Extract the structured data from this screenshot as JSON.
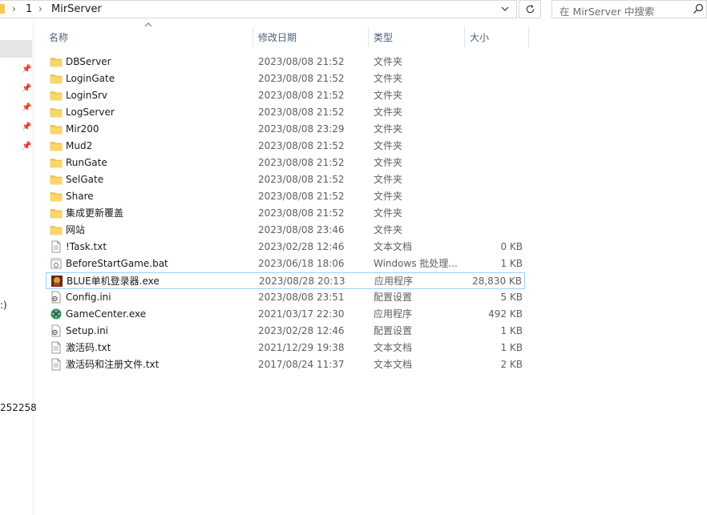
{
  "address": {
    "crumbs": [
      "1",
      "MirServer"
    ],
    "search_placeholder": "在 MirServer 中搜索"
  },
  "nav": {
    "fragments": [
      ":)",
      "252258"
    ]
  },
  "columns": {
    "name": "名称",
    "date": "修改日期",
    "type": "类型",
    "size": "大小"
  },
  "files": [
    {
      "name": "DBServer",
      "date": "2023/08/08 21:52",
      "type": "文件夹",
      "size": "",
      "icon": "folder-icon"
    },
    {
      "name": "LoginGate",
      "date": "2023/08/08 21:52",
      "type": "文件夹",
      "size": "",
      "icon": "folder-icon"
    },
    {
      "name": "LoginSrv",
      "date": "2023/08/08 21:52",
      "type": "文件夹",
      "size": "",
      "icon": "folder-icon"
    },
    {
      "name": "LogServer",
      "date": "2023/08/08 21:52",
      "type": "文件夹",
      "size": "",
      "icon": "folder-icon"
    },
    {
      "name": "Mir200",
      "date": "2023/08/08 23:29",
      "type": "文件夹",
      "size": "",
      "icon": "folder-icon"
    },
    {
      "name": "Mud2",
      "date": "2023/08/08 21:52",
      "type": "文件夹",
      "size": "",
      "icon": "folder-icon"
    },
    {
      "name": "RunGate",
      "date": "2023/08/08 21:52",
      "type": "文件夹",
      "size": "",
      "icon": "folder-icon"
    },
    {
      "name": "SelGate",
      "date": "2023/08/08 21:52",
      "type": "文件夹",
      "size": "",
      "icon": "folder-icon"
    },
    {
      "name": "Share",
      "date": "2023/08/08 21:52",
      "type": "文件夹",
      "size": "",
      "icon": "folder-icon"
    },
    {
      "name": "集成更新覆盖",
      "date": "2023/08/08 21:52",
      "type": "文件夹",
      "size": "",
      "icon": "folder-icon"
    },
    {
      "name": "网站",
      "date": "2023/08/08 23:46",
      "type": "文件夹",
      "size": "",
      "icon": "folder-icon"
    },
    {
      "name": "!Task.txt",
      "date": "2023/02/28 12:46",
      "type": "文本文档",
      "size": "0 KB",
      "icon": "text-file-icon"
    },
    {
      "name": "BeforeStartGame.bat",
      "date": "2023/06/18 18:06",
      "type": "Windows 批处理...",
      "size": "1 KB",
      "icon": "batch-file-icon"
    },
    {
      "name": "BLUE单机登录器.exe",
      "date": "2023/08/28 20:13",
      "type": "应用程序",
      "size": "28,830 KB",
      "icon": "blue-launcher-icon"
    },
    {
      "name": "Config.ini",
      "date": "2023/08/08 23:51",
      "type": "配置设置",
      "size": "5 KB",
      "icon": "ini-file-icon"
    },
    {
      "name": "GameCenter.exe",
      "date": "2021/03/17 22:30",
      "type": "应用程序",
      "size": "492 KB",
      "icon": "gamecenter-icon"
    },
    {
      "name": "Setup.ini",
      "date": "2023/02/28 12:46",
      "type": "配置设置",
      "size": "1 KB",
      "icon": "ini-file-icon"
    },
    {
      "name": "激活码.txt",
      "date": "2021/12/29 19:38",
      "type": "文本文档",
      "size": "1 KB",
      "icon": "text-file-icon"
    },
    {
      "name": "激活码和注册文件.txt",
      "date": "2017/08/24 11:37",
      "type": "文本文档",
      "size": "2 KB",
      "icon": "text-file-icon"
    }
  ],
  "colors": {
    "folder": "#f6c94e",
    "selection_border": "#99d1ff",
    "header_text": "#4c607a"
  }
}
